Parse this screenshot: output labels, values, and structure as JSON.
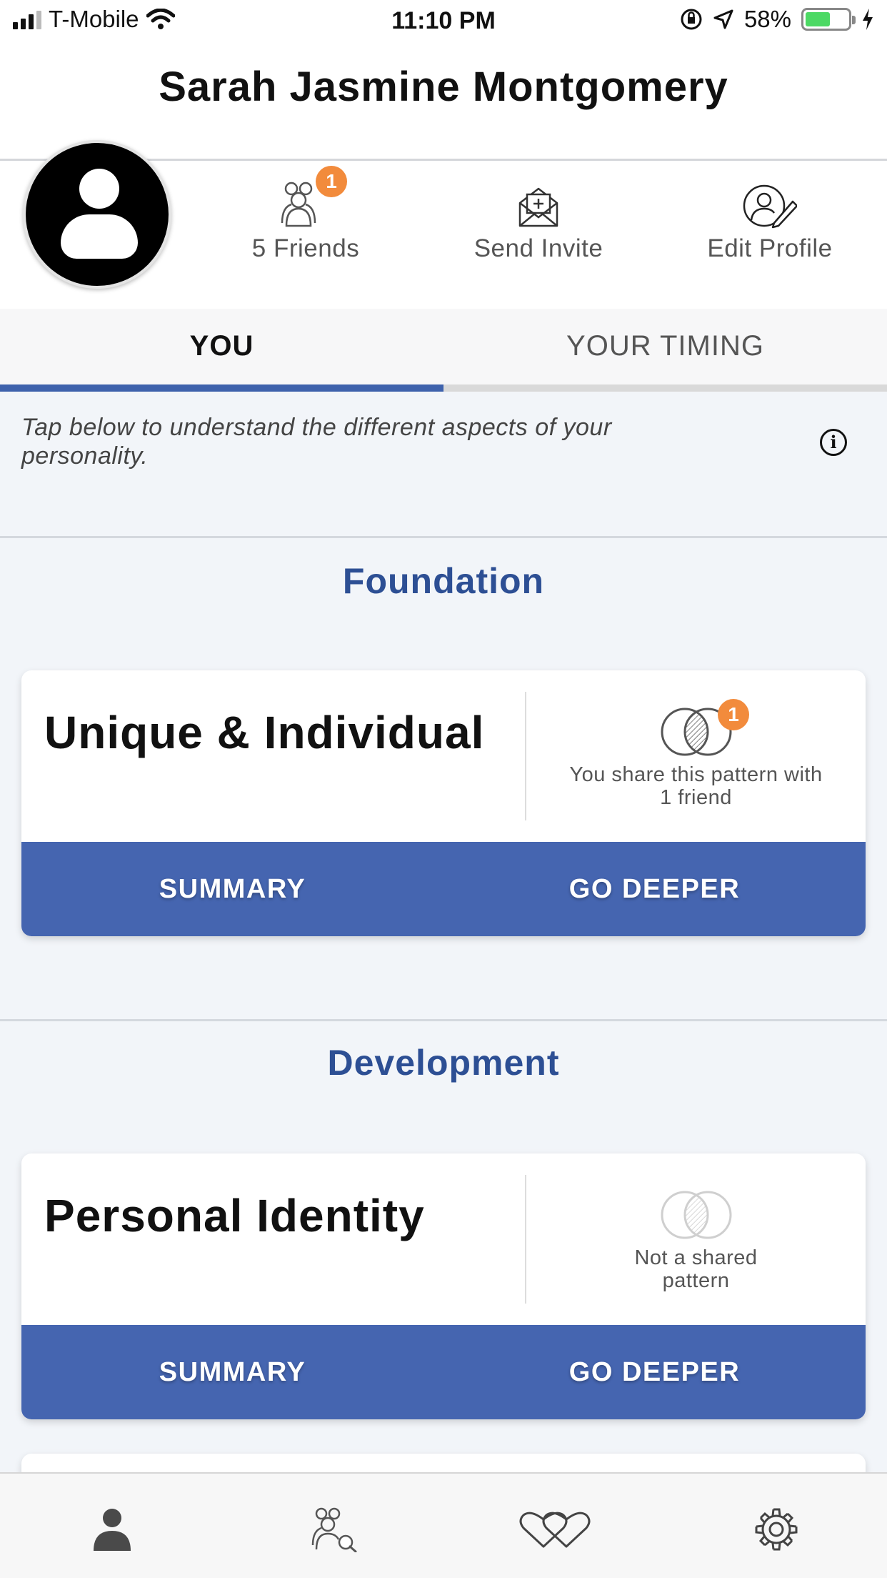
{
  "status_bar": {
    "carrier": "T-Mobile",
    "time": "11:10 PM",
    "battery": "58%",
    "battery_level": 0.58
  },
  "header": {
    "title": "Sarah Jasmine Montgomery"
  },
  "profile": {
    "friends_label": "5 Friends",
    "friends_badge": "1",
    "invite_label": "Send Invite",
    "edit_label": "Edit Profile"
  },
  "tabs": [
    {
      "label": "YOU",
      "active": true
    },
    {
      "label": "YOUR TIMING",
      "active": false
    }
  ],
  "intro_text": "Tap below to understand the different aspects of your personality.",
  "info_icon_glyph": "i",
  "sections": [
    {
      "title": "Foundation",
      "card": {
        "title": "Unique & Individual",
        "badge": "1",
        "share_line1": "You share this pattern with",
        "share_line2": "1 friend",
        "summary_label": "SUMMARY",
        "deeper_label": "GO DEEPER"
      }
    },
    {
      "title": "Development",
      "card": {
        "title": "Personal Identity",
        "share_line1": "Not a shared",
        "share_line2": "pattern",
        "summary_label": "SUMMARY",
        "deeper_label": "GO DEEPER"
      }
    }
  ],
  "bottom_nav": [
    {
      "icon": "person-icon",
      "active": true
    },
    {
      "icon": "friends-search-icon",
      "active": false
    },
    {
      "icon": "hearts-icon",
      "active": false
    },
    {
      "icon": "gear-icon",
      "active": false
    }
  ],
  "colors": {
    "accent": "#3e62ac",
    "button_bar": "#4565b0",
    "section_title": "#2d4f94",
    "badge": "#f28b3c"
  }
}
